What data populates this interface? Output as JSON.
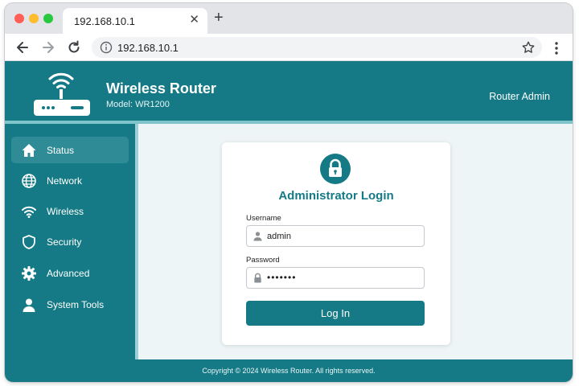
{
  "browser": {
    "tab_title": "192.168.10.1",
    "tab_close": "✕",
    "new_tab": "+",
    "url": "192.168.10.1"
  },
  "header": {
    "title": "Wireless Router",
    "model": "Model: WR1200",
    "admin_label": "Router Admin"
  },
  "sidebar": {
    "items": [
      {
        "label": "Status",
        "icon": "home-icon",
        "active": true
      },
      {
        "label": "Network",
        "icon": "globe-icon",
        "active": false
      },
      {
        "label": "Wireless",
        "icon": "wifi-icon",
        "active": false
      },
      {
        "label": "Security",
        "icon": "shield-icon",
        "active": false
      },
      {
        "label": "Advanced",
        "icon": "gear-icon",
        "active": false
      },
      {
        "label": "System Tools",
        "icon": "user-icon",
        "active": false
      }
    ]
  },
  "login": {
    "title": "Administrator Login",
    "username_label": "Username",
    "username_value": "admin",
    "password_label": "Password",
    "password_value": "•••••••",
    "button_label": "Log In"
  },
  "footer": {
    "text": "Copyright © 2024 Wireless Router. All rights reserved."
  },
  "colors": {
    "primary": "#157a85",
    "page_background": "#eef5f7",
    "active_nav": "#2f8c96"
  }
}
